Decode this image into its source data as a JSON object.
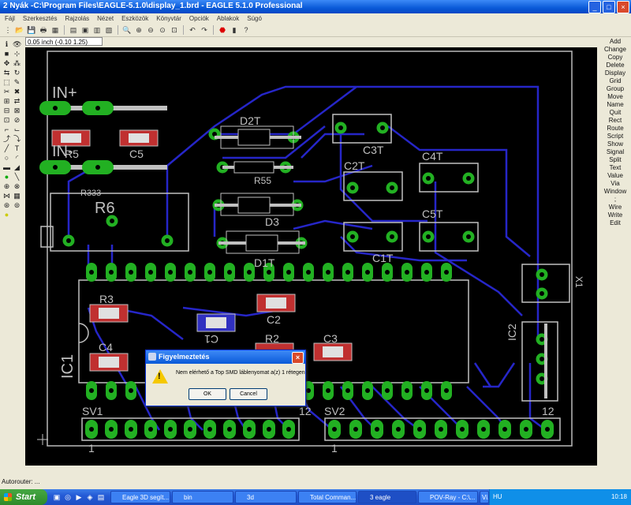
{
  "window": {
    "title": "2 Nyák -C:\\Program Files\\EAGLE-5.1.0\\display_1.brd - EAGLE 5.1.0 Professional"
  },
  "menu": [
    "Fájl",
    "Szerkesztés",
    "Rajzolás",
    "Nézet",
    "Eszközök",
    "Könyvtár",
    "Opciók",
    "Ablakok",
    "Súgó"
  ],
  "coord_readout": "0.05 inch (-0.10 1.25)",
  "board": {
    "labels": [
      "IN+",
      "IN-",
      "R5",
      "C5",
      "R333",
      "R6",
      "D2T",
      "R55",
      "D3",
      "D1T",
      "C3T",
      "C2T",
      "C4T",
      "C5T",
      "C1T",
      "X1",
      "R3",
      "C1",
      "C2",
      "C4",
      "R2",
      "C3",
      "IC1",
      "IC2",
      "SV1",
      "SV2",
      "12",
      "12",
      "1",
      "1"
    ]
  },
  "commands": [
    "Add",
    "Change",
    "Copy",
    "Delete",
    "Display",
    "Grid",
    "Group",
    "Move",
    "Name",
    "Quit",
    "Rect",
    "Route",
    "Script",
    "Show",
    "Signal",
    "Split",
    "Text",
    "Value",
    "Via",
    "Window",
    ";",
    "Wire",
    "Write",
    "Edit"
  ],
  "status": "Autorouter: ...",
  "dialog": {
    "title": "Figyelmeztetés",
    "message": "Nem elérhető a Top SMD láblenyomat a(z) 1 rétegen",
    "ok": "OK",
    "cancel": "Cancel"
  },
  "taskbar": {
    "start": "Start",
    "tasks": [
      "Eagle 3D segít...",
      "bin",
      "3d",
      "Total Comman...",
      "3 eagle",
      "POV-Ray - C:\\...",
      "Vi..."
    ],
    "lang": "HU",
    "clock": "10:18"
  },
  "colors": {
    "board_bg": "#000000",
    "trace": "#2626c8",
    "pad": "#22b022",
    "silk": "#c0c0c0",
    "smd_red": "#c03030",
    "smd_blue": "#3030c0"
  }
}
